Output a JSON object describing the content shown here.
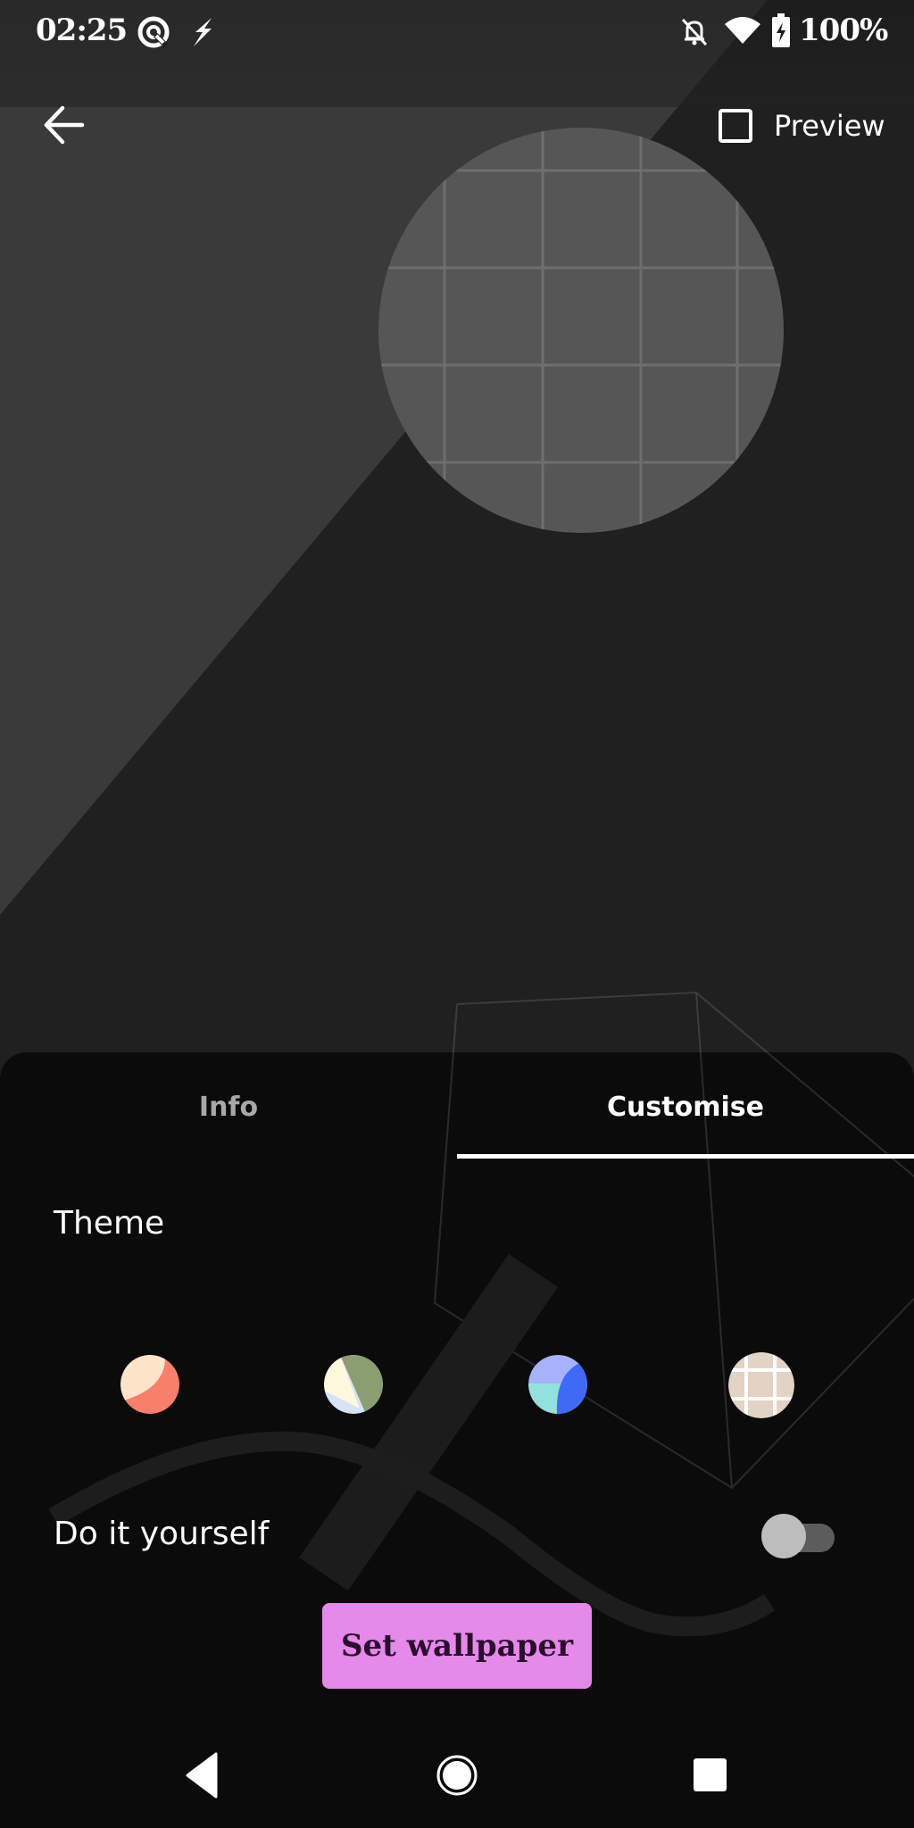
{
  "status_bar": {
    "time": "02:25",
    "left_icons": [
      "q-logo-icon",
      "lightning-icon"
    ],
    "right_icons": [
      "bell-off-icon",
      "wifi-icon",
      "battery-charging-icon"
    ],
    "battery": "100%"
  },
  "top_bar": {
    "back_icon": "arrow-left-icon",
    "preview_label": "Preview",
    "preview_checked": false
  },
  "tabs": [
    {
      "label": "Info",
      "selected": false
    },
    {
      "label": "Customise",
      "selected": true
    }
  ],
  "theme": {
    "title": "Theme",
    "options": [
      {
        "name": "coral-peach",
        "colors": [
          "#fde4c8",
          "#f87f6a"
        ]
      },
      {
        "name": "sage-cream-blue",
        "colors": [
          "#8a9e72",
          "#fdf7dc",
          "#d7e2f5"
        ]
      },
      {
        "name": "blue-aqua",
        "colors": [
          "#a6b2fb",
          "#92e1df",
          "#3e6af5"
        ]
      },
      {
        "name": "beige-grid",
        "colors": [
          "#e2d3c4",
          "#ffffff"
        ]
      }
    ]
  },
  "diy": {
    "label": "Do it yourself",
    "enabled": false
  },
  "set_wallpaper_label": "Set wallpaper",
  "colors": {
    "accent_button": "#e589ea",
    "sheet_bg": "#0d0d0d"
  },
  "nav": [
    "nav-back-icon",
    "nav-home-icon",
    "nav-recents-icon"
  ]
}
